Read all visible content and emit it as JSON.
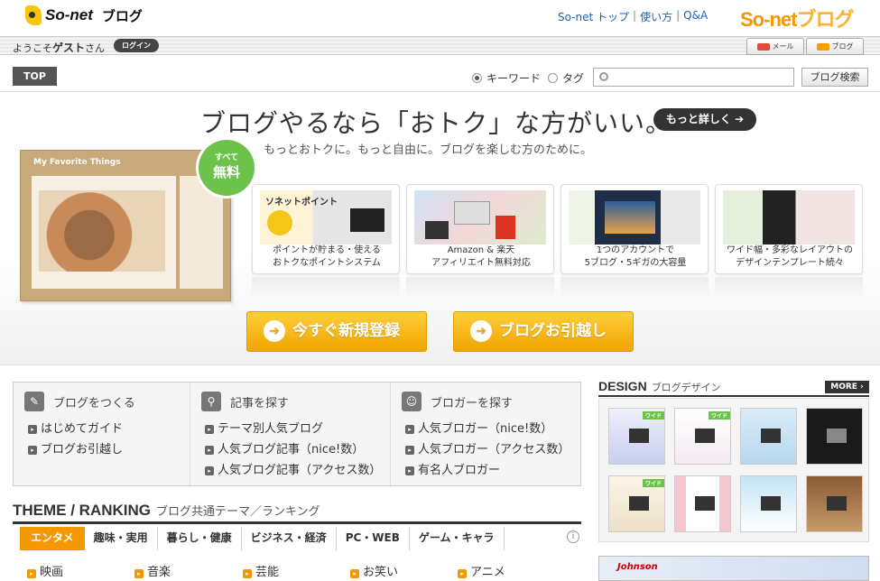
{
  "header": {
    "logo_text": "So-net",
    "logo_blog": "ブログ",
    "links": [
      "So-net トップ",
      "使い方",
      "Q&A"
    ],
    "link_separator": "|",
    "brand_a": "So-net",
    "brand_b": "ブログ"
  },
  "welcome": {
    "prefix": "ようこそ",
    "user": "ゲスト",
    "suffix": "さん",
    "login_label": "ログイン",
    "mail_label": "メール",
    "blog_label": "ブログ"
  },
  "search": {
    "top_label": "TOP",
    "radio_keyword": "キーワード",
    "radio_tag": "タグ",
    "placeholder": "",
    "button_label": "ブログ検索"
  },
  "hero": {
    "title": "ブログやるなら「おトク」な方がいい。",
    "more_label": "もっと詳しく",
    "subtitle": "もっとおトクに。もっと自由に。ブログを楽しむ方のために。",
    "sample_title": "My Favorite Things",
    "badge_small": "すべて",
    "badge_large": "無料",
    "cards": [
      {
        "line1": "ポイントが貯まる・使える",
        "line2": "おトクなポイントシステム",
        "brand": "ソネットポイント"
      },
      {
        "line1": "Amazon & 楽天",
        "line2": "アフィリエイト無料対応"
      },
      {
        "line1": "1つのアカウントで",
        "line2": "5ブログ・5ギガの大容量"
      },
      {
        "line1": "ワイド幅・多彩なレイアウトの",
        "line2": "デザインテンプレート続々"
      }
    ],
    "cta_register": "今すぐ新規登録",
    "cta_move": "ブログお引越し"
  },
  "nav": {
    "col1": {
      "title": "ブログをつくる",
      "items": [
        "はじめてガイド",
        "ブログお引越し"
      ]
    },
    "col2": {
      "title": "記事を探す",
      "items": [
        "テーマ別人気ブログ",
        "人気ブログ記事（nice!数）",
        "人気ブログ記事（アクセス数）"
      ]
    },
    "col3": {
      "title": "ブロガーを探す",
      "items": [
        "人気ブロガー（nice!数）",
        "人気ブロガー（アクセス数）",
        "有名人ブロガー"
      ]
    }
  },
  "theme": {
    "title": "THEME / RANKING",
    "subtitle": "ブログ共通テーマ／ランキング",
    "tabs": [
      "エンタメ",
      "趣味・実用",
      "暮らし・健康",
      "ビジネス・経済",
      "PC・WEB",
      "ゲーム・キャラ"
    ],
    "more_symbol": "i",
    "subitems": [
      "映画",
      "音楽",
      "芸能",
      "お笑い",
      "アニメ"
    ]
  },
  "design": {
    "title": "DESIGN",
    "subtitle": "ブログデザイン",
    "more_label": "MORE",
    "wide_label": "ワイド"
  },
  "ad": {
    "text": "Johnson"
  },
  "colors": {
    "accent": "#f39800",
    "link": "#1a63b8",
    "badge": "#6cc24a"
  }
}
